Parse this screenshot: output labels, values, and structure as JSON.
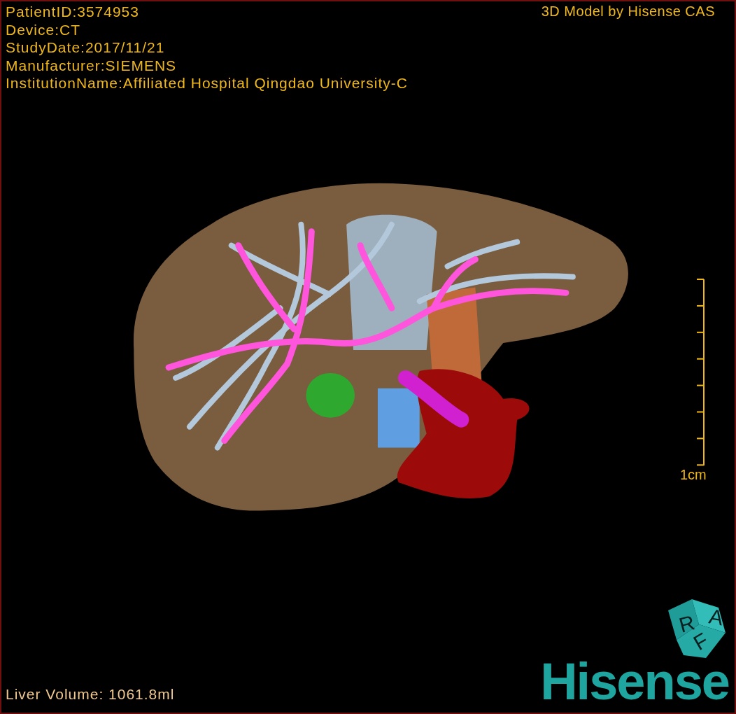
{
  "study_info": [
    "PatientID:3574953",
    "Device:CT",
    "StudyDate:2017/11/21",
    "Manufacturer:SIEMENS",
    "InstitutionName:Affiliated Hospital Qingdao University-C"
  ],
  "model_credit": "3D Model by Hisense CAS",
  "scale_bar": {
    "label": "1cm"
  },
  "orientation_cube": {
    "faces": [
      "R",
      "A",
      "F"
    ]
  },
  "liver_volume": "Liver Volume: 1061.8ml",
  "logo": "Hisense"
}
